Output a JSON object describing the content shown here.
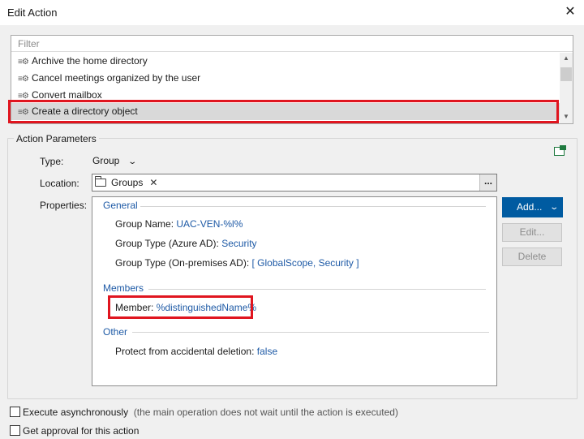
{
  "window": {
    "title": "Edit Action",
    "close_icon": "close-icon"
  },
  "action_list": {
    "filter_placeholder": "Filter",
    "items": [
      {
        "label": "Archive the home directory",
        "icon": "action-gear-icon"
      },
      {
        "label": "Cancel meetings organized by the user",
        "icon": "action-gear-icon"
      },
      {
        "label": "Convert mailbox",
        "icon": "action-gear-icon"
      },
      {
        "label": "Create a directory object",
        "icon": "action-gear-icon",
        "selected": true
      }
    ]
  },
  "parameters": {
    "legend": "Action Parameters",
    "type_label": "Type:",
    "type_value": "Group",
    "location_label": "Location:",
    "location_chip": "Groups",
    "browse_label": "...",
    "properties_label": "Properties:",
    "sections": {
      "general": {
        "title": "General",
        "group_name_label": "Group Name:",
        "group_name_value": "UAC-VEN-%l%",
        "group_type_azure_label": "Group Type (Azure AD):",
        "group_type_azure_value": "Security",
        "group_type_onprem_label": "Group Type (On-premises AD):",
        "group_type_onprem_value": "[ GlobalScope, Security ]"
      },
      "members": {
        "title": "Members",
        "member_label": "Member:",
        "member_value": "%distinguishedName%"
      },
      "other": {
        "title": "Other",
        "protect_label": "Protect from accidental deletion:",
        "protect_value": "false"
      }
    },
    "buttons": {
      "add": "Add...",
      "edit": "Edit...",
      "delete": "Delete"
    }
  },
  "options": {
    "execute_async_label": "Execute asynchronously",
    "execute_async_note": "(the main operation does not wait until the action is executed)",
    "execute_async_checked": false,
    "approval_label": "Get approval for this action",
    "approval_checked": false
  },
  "colors": {
    "accent": "#005ba1",
    "link": "#1e5aa6",
    "highlight": "#e0151f",
    "selection": "#d9d9d9"
  }
}
